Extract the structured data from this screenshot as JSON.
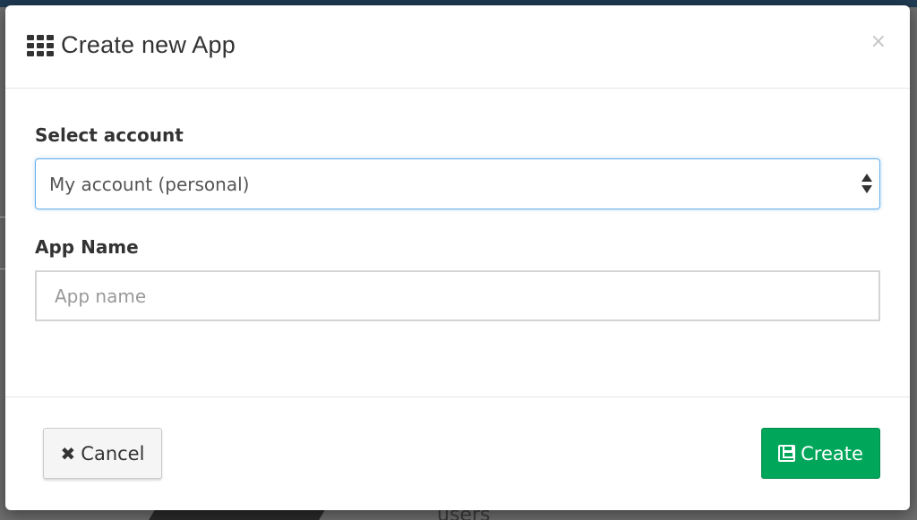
{
  "modal": {
    "title": "Create new App",
    "close_label": "×"
  },
  "form": {
    "account_label": "Select account",
    "account_selected": "My account (personal)",
    "app_name_label": "App Name",
    "app_name_placeholder": "App name",
    "app_name_value": ""
  },
  "footer": {
    "cancel_label": "Cancel",
    "create_label": "Create"
  },
  "icons": {
    "title_icon": "th-grid-icon",
    "cancel_icon": "times-icon",
    "create_icon": "floppy-disk-icon"
  },
  "colors": {
    "create_button": "#00a65a",
    "select_focus_border": "#66afe9"
  },
  "background": {
    "bottom_text": "users"
  }
}
